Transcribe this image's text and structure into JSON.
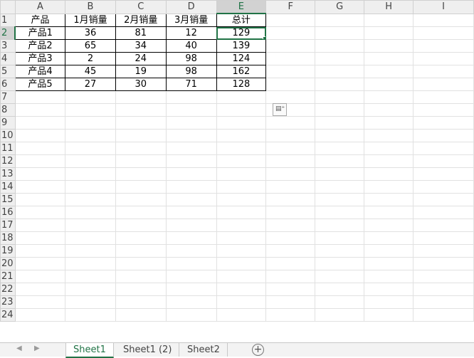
{
  "columns": [
    "A",
    "B",
    "C",
    "D",
    "E",
    "F",
    "G",
    "H",
    "I"
  ],
  "rows": [
    "1",
    "2",
    "3",
    "4",
    "5",
    "6",
    "7",
    "8",
    "9",
    "10",
    "11",
    "12",
    "13",
    "14",
    "15",
    "16",
    "17",
    "18",
    "19",
    "20",
    "21",
    "22",
    "23",
    "24"
  ],
  "table": {
    "headers": [
      "产品",
      "1月销量",
      "2月销量",
      "3月销量",
      "总计"
    ],
    "data": [
      [
        "产品1",
        "36",
        "81",
        "12",
        "129"
      ],
      [
        "产品2",
        "65",
        "34",
        "40",
        "139"
      ],
      [
        "产品3",
        "2",
        "24",
        "98",
        "124"
      ],
      [
        "产品4",
        "45",
        "19",
        "98",
        "162"
      ],
      [
        "产品5",
        "27",
        "30",
        "71",
        "128"
      ]
    ]
  },
  "selected_cell": "E2",
  "paste_options_icon": "paste-options-icon",
  "sheet_tabs": [
    "Sheet1",
    "Sheet1 (2)",
    "Sheet2"
  ],
  "active_sheet": "Sheet1",
  "accent_color": "#217346"
}
